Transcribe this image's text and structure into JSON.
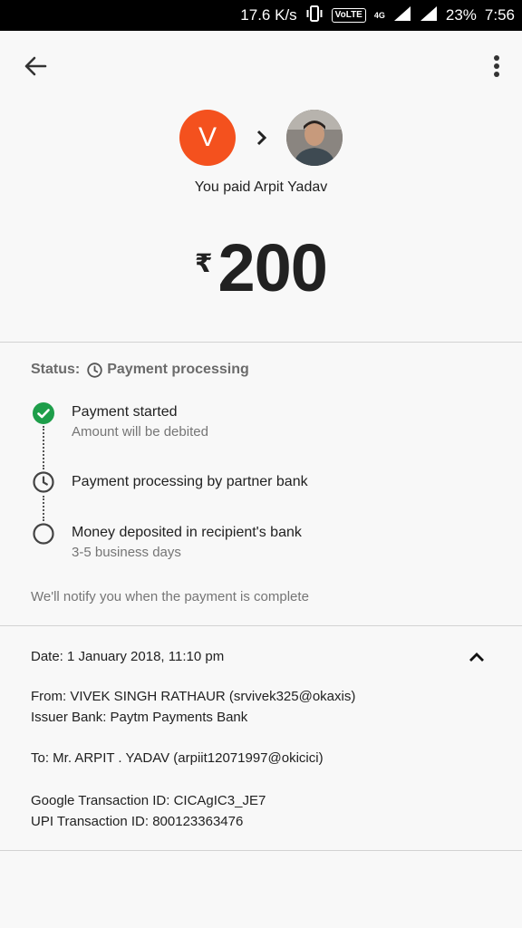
{
  "status_bar": {
    "speed": "17.6 K/s",
    "volte": "VoLTE",
    "network": "4G",
    "battery": "23%",
    "time": "7:56"
  },
  "header": {
    "back_icon": "arrow-back-icon",
    "menu_icon": "more-vert-icon"
  },
  "payment": {
    "payer_initial": "V",
    "payer_avatar_color": "#f4511e",
    "paid_text": "You paid Arpit Yadav",
    "currency_symbol": "₹",
    "amount": "200"
  },
  "status": {
    "label": "Status:",
    "value": "Payment processing"
  },
  "steps": [
    {
      "title": "Payment started",
      "subtitle": "Amount will be debited",
      "state": "done"
    },
    {
      "title": "Payment processing by partner bank",
      "subtitle": "",
      "state": "in-progress"
    },
    {
      "title": "Money deposited in recipient's bank",
      "subtitle": "3-5 business days",
      "state": "pending"
    }
  ],
  "notify_text": "We'll notify you when the payment is complete",
  "details": {
    "date": "Date: 1 January 2018, 11:10 pm",
    "from": "From: VIVEK SINGH RATHAUR (srvivek325@okaxis)",
    "issuer_bank": "Issuer Bank: Paytm Payments Bank",
    "to": "To: Mr. ARPIT . YADAV (arpiit12071997@okicici)",
    "google_txn_id": "Google Transaction ID: CICAgIC3_JE7",
    "upi_txn_id": "UPI Transaction ID: 800123363476"
  },
  "colors": {
    "accent_orange": "#f4511e",
    "success_green": "#1e9e4a"
  }
}
